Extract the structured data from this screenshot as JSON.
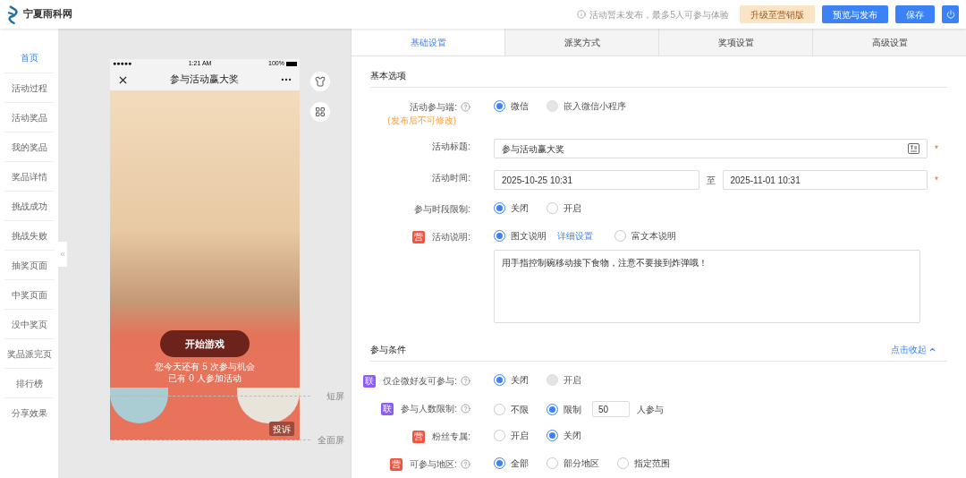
{
  "header": {
    "logo": "宁夏雨科网",
    "notice": "活动暂未发布，最多5人可参与体验",
    "buttons": [
      {
        "label": "升级至营销版",
        "kind": "upgrade"
      },
      {
        "label": "预览与发布",
        "kind": "primary"
      },
      {
        "label": "保存",
        "kind": "primary"
      }
    ]
  },
  "sidebar": {
    "items": [
      {
        "label": "首页",
        "selected": true
      },
      {
        "label": "活动过程",
        "selected": false
      },
      {
        "label": "活动奖品",
        "selected": false
      },
      {
        "label": "我的奖品",
        "selected": false
      },
      {
        "label": "奖品详情",
        "selected": false
      },
      {
        "label": "挑战成功",
        "selected": false
      },
      {
        "label": "挑战失败",
        "selected": false
      },
      {
        "label": "抽奖页面",
        "selected": false
      },
      {
        "label": "中奖页面",
        "selected": false
      },
      {
        "label": "没中奖页",
        "selected": false
      },
      {
        "label": "奖品派完页",
        "selected": false
      },
      {
        "label": "排行榜",
        "selected": false
      },
      {
        "label": "分享效果",
        "selected": false
      }
    ]
  },
  "preview": {
    "status": {
      "signal": "●●●●●",
      "time": "1:21 AM",
      "battery": "100%"
    },
    "title": "参与活动赢大奖",
    "start_button": "开始游戏",
    "chances": "您今天还有 5 次参与机会",
    "participants": "已有 0 人参加活动",
    "complaint": "投诉",
    "markers": [
      "短屏",
      "全面屏"
    ]
  },
  "tabs": [
    {
      "label": "基础设置",
      "selected": true
    },
    {
      "label": "派奖方式",
      "selected": false
    },
    {
      "label": "奖项设置",
      "selected": false
    },
    {
      "label": "高级设置",
      "selected": false
    }
  ],
  "sections": [
    {
      "title": "基本选项",
      "rows": [
        {
          "kind": "radio",
          "label": "活动参与端:",
          "note": "(发布后不可修改)",
          "help": true,
          "options": [
            {
              "label": "微信",
              "selected": true,
              "disabled": false
            },
            {
              "label": "嵌入微信小程序",
              "selected": false,
              "disabled": true
            }
          ]
        },
        {
          "kind": "text",
          "label": "活动标题:",
          "value": "参与活动赢大奖",
          "required": "*"
        },
        {
          "kind": "daterange",
          "label": "活动时间:",
          "start": "2025-10-25 10:31",
          "separator": "至",
          "end": "2025-11-01 10:31",
          "required": "*"
        },
        {
          "kind": "radio",
          "label": "参与时段限制:",
          "options": [
            {
              "label": "关闭",
              "selected": true,
              "disabled": false
            },
            {
              "label": "开启",
              "selected": false,
              "disabled": false
            }
          ]
        },
        {
          "kind": "radio",
          "label": "活动说明:",
          "badge": {
            "text": "营",
            "color": "#f0533f"
          },
          "options": [
            {
              "label": "图文说明",
              "selected": true,
              "disabled": false,
              "link": "详细设置"
            },
            {
              "label": "富文本说明",
              "selected": false,
              "disabled": false
            }
          ],
          "textarea": "用手指控制碗移动接下食物，注意不要接到炸弹哦！"
        }
      ]
    },
    {
      "title": "参与条件",
      "toggle": "点击收起",
      "rows": [
        {
          "kind": "radio",
          "label": "仅企微好友可参与:",
          "help": true,
          "badge": {
            "text": "联",
            "color": "#8b5cf6"
          },
          "options": [
            {
              "label": "关闭",
              "selected": true,
              "disabled": false
            },
            {
              "label": "开启",
              "selected": false,
              "disabled": true
            }
          ]
        },
        {
          "kind": "radio",
          "label": "参与人数限制:",
          "help": true,
          "badge": {
            "text": "联",
            "color": "#8b5cf6"
          },
          "options": [
            {
              "label": "不限",
              "selected": false,
              "disabled": false
            },
            {
              "label": "限制",
              "selected": true,
              "disabled": false
            }
          ],
          "input": "50",
          "suffix": "人参与"
        },
        {
          "kind": "radio",
          "label": "粉丝专属:",
          "badge": {
            "text": "营",
            "color": "#f0533f"
          },
          "options": [
            {
              "label": "开启",
              "selected": false,
              "disabled": false
            },
            {
              "label": "关闭",
              "selected": true,
              "disabled": false
            }
          ]
        },
        {
          "kind": "radio",
          "label": "可参与地区:",
          "help": true,
          "badge": {
            "text": "营",
            "color": "#f0533f"
          },
          "options": [
            {
              "label": "全部",
              "selected": true,
              "disabled": false
            },
            {
              "label": "部分地区",
              "selected": false,
              "disabled": false
            },
            {
              "label": "指定范围",
              "selected": false,
              "disabled": false
            }
          ]
        }
      ]
    }
  ]
}
